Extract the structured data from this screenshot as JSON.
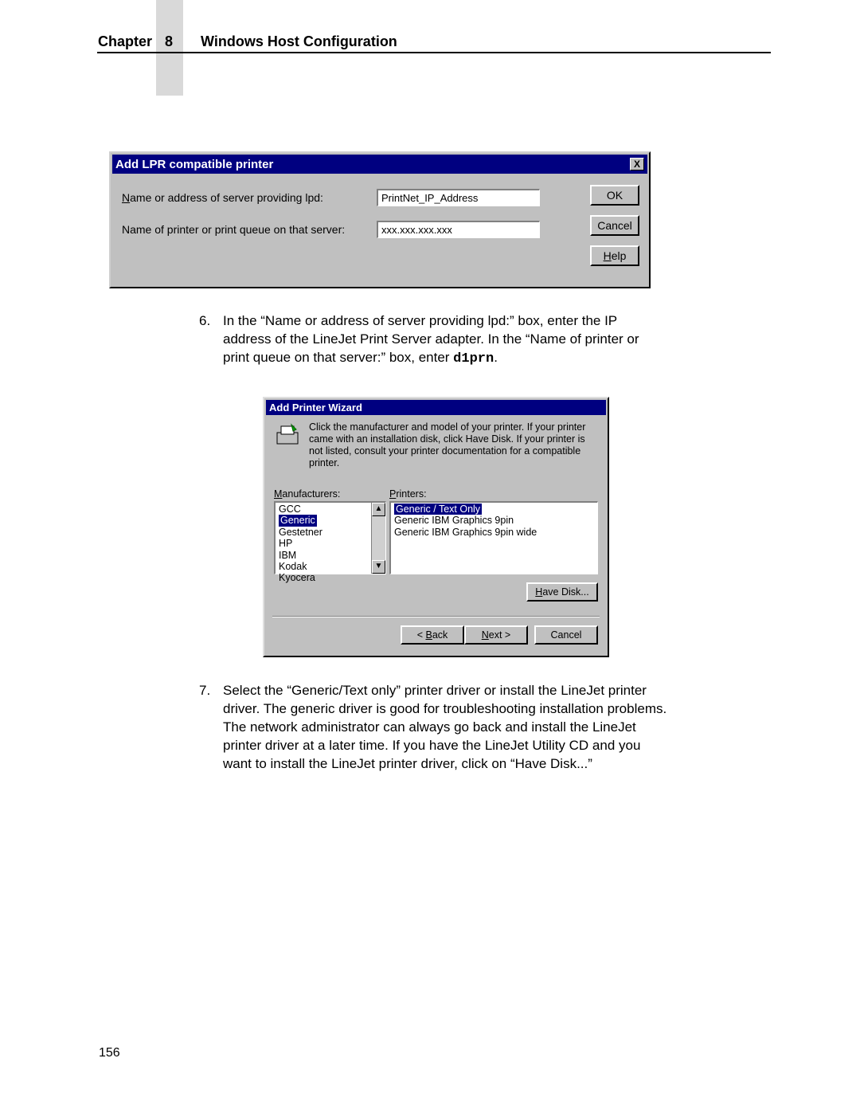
{
  "header": {
    "chapter_label": "Chapter",
    "chapter_number": "8",
    "chapter_title": "Windows Host Configuration"
  },
  "lpr_dialog": {
    "title": "Add LPR compatible printer",
    "close_x": "X",
    "label_server": "Name or address of server providing lpd:",
    "label_queue": "Name of printer or print queue on that server:",
    "value_server": "PrintNet_IP_Address",
    "value_queue": "xxx.xxx.xxx.xxx",
    "btn_ok": "OK",
    "btn_cancel": "Cancel",
    "btn_help": "Help",
    "btn_help_ul": "H"
  },
  "step6": {
    "num": "6.",
    "text_a": "In the “Name or address of server providing lpd:” box, enter the IP address of the LineJet Print Server adapter. In the “Name of printer or print queue on that server:” box, enter ",
    "code": "d1prn",
    "text_b": "."
  },
  "wizard": {
    "title": "Add Printer Wizard",
    "desc": "Click the manufacturer and model of your printer.  If your printer came with an installation disk, click Have Disk.  If your printer is not listed, consult your printer documentation for a compatible printer.",
    "label_manufacturers": "Manufacturers:",
    "label_printers": "Printers:",
    "manufacturers": [
      "GCC",
      "Generic",
      "Gestetner",
      "HP",
      "IBM",
      "Kodak",
      "Kyocera"
    ],
    "manufacturer_selected_index": 1,
    "printers": [
      "Generic / Text Only",
      "Generic IBM Graphics 9pin",
      "Generic IBM Graphics 9pin wide"
    ],
    "printer_selected_index": 0,
    "btn_have_disk": "Have Disk...",
    "btn_back": "< Back",
    "btn_next": "Next >",
    "btn_cancel": "Cancel"
  },
  "step7": {
    "num": "7.",
    "text": "Select the “Generic/Text only” printer driver or install the LineJet printer driver. The generic driver is good for troubleshooting installation problems. The network administrator can always go back and install the LineJet printer driver at a later time. If you have the LineJet Utility CD and you want to install the LineJet printer driver, click on “Have Disk...”"
  },
  "page_number": "156"
}
